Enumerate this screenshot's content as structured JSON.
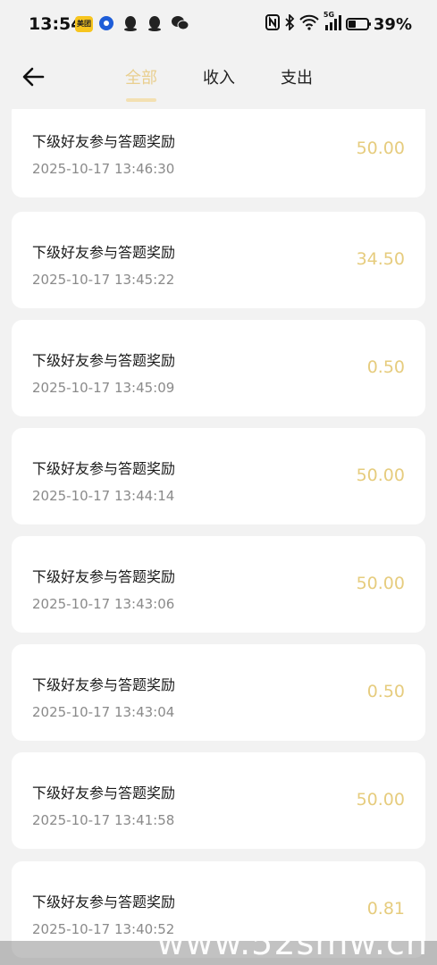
{
  "status": {
    "time": "13:54",
    "app_badge": "美团",
    "battery": "39%",
    "battery_level": 0.39,
    "network": "5G"
  },
  "nav": {
    "tabs": [
      "全部",
      "收入",
      "支出"
    ],
    "active_tab": "全部"
  },
  "records": [
    {
      "title": "下级好友参与答题奖励",
      "time": "2025-10-17 13:46:30",
      "amount": "50.00"
    },
    {
      "title": "下级好友参与答题奖励",
      "time": "2025-10-17 13:45:22",
      "amount": "34.50"
    },
    {
      "title": "下级好友参与答题奖励",
      "time": "2025-10-17 13:45:09",
      "amount": "0.50"
    },
    {
      "title": "下级好友参与答题奖励",
      "time": "2025-10-17 13:44:14",
      "amount": "50.00"
    },
    {
      "title": "下级好友参与答题奖励",
      "time": "2025-10-17 13:43:06",
      "amount": "50.00"
    },
    {
      "title": "下级好友参与答题奖励",
      "time": "2025-10-17 13:43:04",
      "amount": "0.50"
    },
    {
      "title": "下级好友参与答题奖励",
      "time": "2025-10-17 13:41:58",
      "amount": "50.00"
    },
    {
      "title": "下级好友参与答题奖励",
      "time": "2025-10-17 13:40:52",
      "amount": "0.81"
    }
  ],
  "watermark": "www.52smw.cn"
}
